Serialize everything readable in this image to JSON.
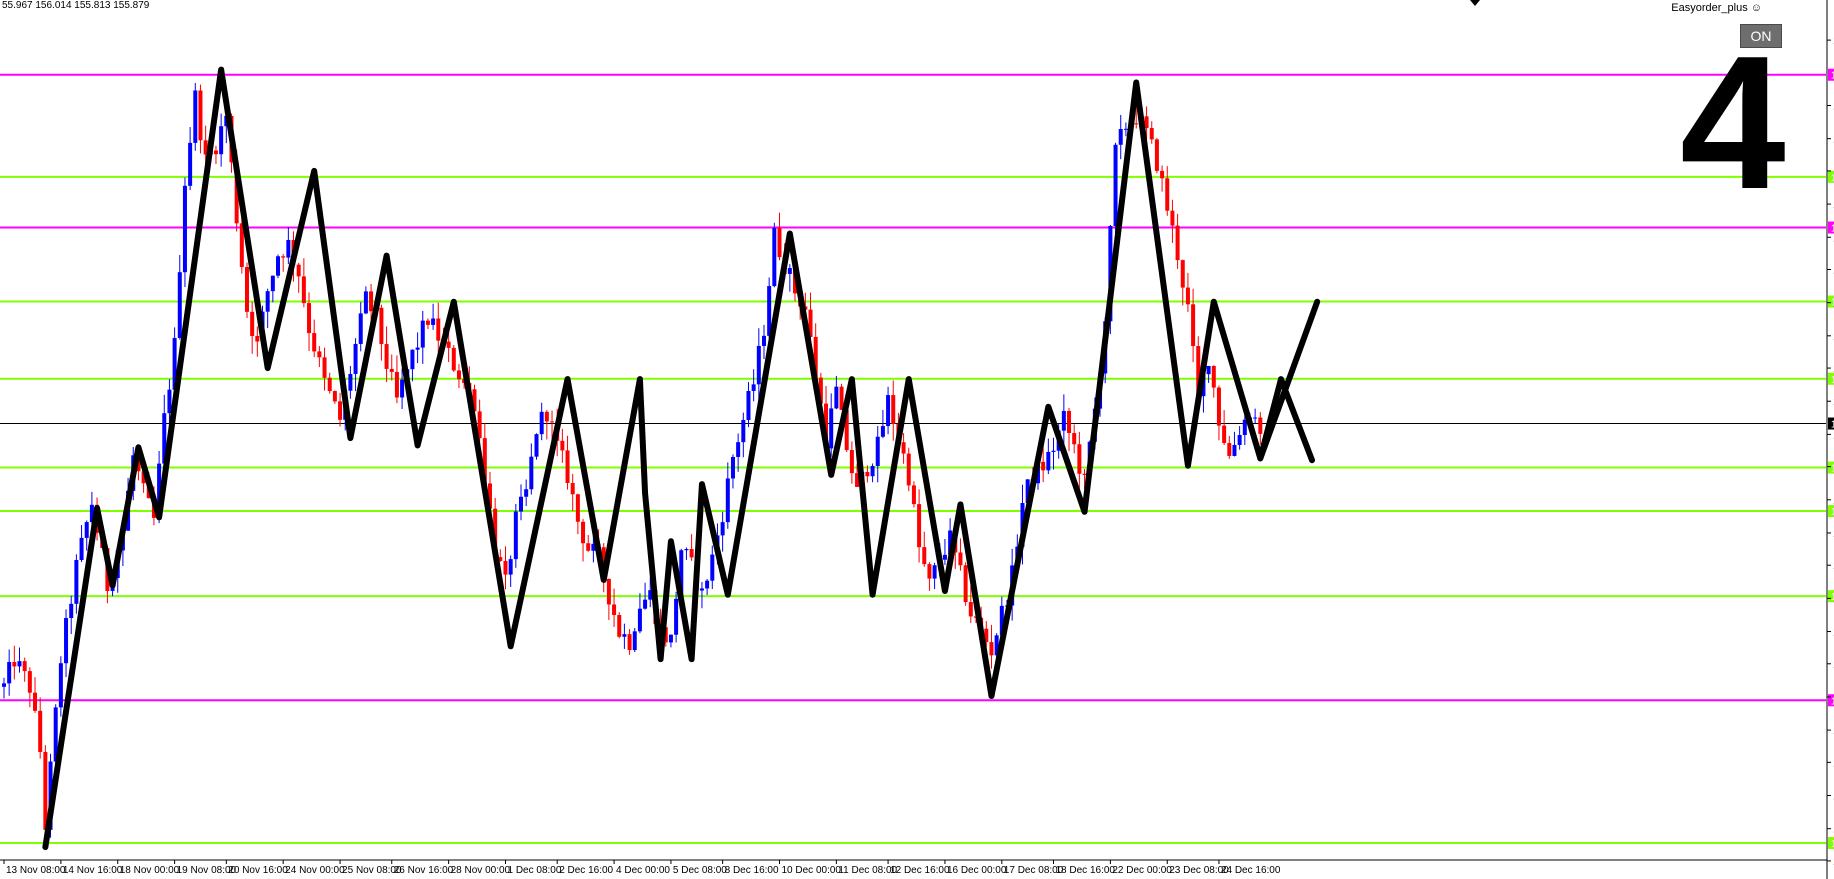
{
  "ohlc_readout": "55.967 156.014 155.813 155.879",
  "indicator_name": "Easyorder_plus",
  "on_button_label": "ON",
  "wave_count_label": "4",
  "colors": {
    "bull": "#0000ff",
    "bear": "#ff0000",
    "magenta_level": "#ff00ff",
    "green_level": "#7fff00",
    "zigzag": "#000000",
    "bid_line": "#000000"
  },
  "chart_data": {
    "type": "candlestick",
    "ylim": [
      153.51,
      158.08
    ],
    "price_ticks": [
      "157.960",
      "157.605",
      "157.425",
      "157.250",
      "157.070",
      "156.890",
      "156.715",
      "156.535",
      "156.355",
      "156.180",
      "156.000",
      "155.820",
      "155.645",
      "155.465",
      "155.285",
      "155.110",
      "154.930",
      "154.750",
      "154.575",
      "154.395",
      "154.215",
      "154.040",
      "153.860",
      "153.680",
      "153.505"
    ],
    "time_labels": [
      {
        "label": "13 Nov 08:00",
        "bar": 0
      },
      {
        "label": "14 Nov 16:00",
        "bar": 11
      },
      {
        "label": "18 Nov 00:00",
        "bar": 22
      },
      {
        "label": "19 Nov 08:00",
        "bar": 33
      },
      {
        "label": "20 Nov 16:00",
        "bar": 43
      },
      {
        "label": "24 Nov 00:00",
        "bar": 54
      },
      {
        "label": "25 Nov 08:00",
        "bar": 65
      },
      {
        "label": "26 Nov 16:00",
        "bar": 75
      },
      {
        "label": "28 Nov 00:00",
        "bar": 86
      },
      {
        "label": "1 Dec 08:00",
        "bar": 97
      },
      {
        "label": "2 Dec 16:00",
        "bar": 107
      },
      {
        "label": "4 Dec 00:00",
        "bar": 118
      },
      {
        "label": "5 Dec 08:00",
        "bar": 129
      },
      {
        "label": "8 Dec 16:00",
        "bar": 139
      },
      {
        "label": "10 Dec 00:00",
        "bar": 150
      },
      {
        "label": "11 Dec 08:00",
        "bar": 161
      },
      {
        "label": "12 Dec 16:00",
        "bar": 171
      },
      {
        "label": "16 Dec 00:00",
        "bar": 182
      },
      {
        "label": "17 Dec 08:00",
        "bar": 193
      },
      {
        "label": "18 Dec 16:00",
        "bar": 203
      },
      {
        "label": "22 Dec 00:00",
        "bar": 214
      },
      {
        "label": "23 Dec 08:00",
        "bar": 225
      },
      {
        "label": "24 Dec 16:00",
        "bar": 235
      }
    ],
    "levels": [
      {
        "price": 157.772,
        "label": "157.772",
        "kind": "magenta"
      },
      {
        "price": 157.218,
        "label": "157.218",
        "kind": "green"
      },
      {
        "price": 156.943,
        "label": "156.943",
        "kind": "magenta"
      },
      {
        "price": 156.541,
        "label": "156.541",
        "kind": "green"
      },
      {
        "price": 156.122,
        "label": "156.122",
        "kind": "green"
      },
      {
        "price": 155.64,
        "label": "155.640",
        "kind": "green"
      },
      {
        "price": 155.404,
        "label": "155.404",
        "kind": "green"
      },
      {
        "price": 154.942,
        "label": "154.942",
        "kind": "green"
      },
      {
        "price": 154.377,
        "label": "154.377",
        "kind": "magenta"
      },
      {
        "price": 153.602,
        "label": "153.602",
        "kind": "green"
      }
    ],
    "current_price": {
      "price": 155.879,
      "label": "155.879"
    },
    "waypoints": [
      [
        0,
        154.45
      ],
      [
        2,
        154.6
      ],
      [
        5,
        154.45
      ],
      [
        7,
        154.1
      ],
      [
        8,
        153.7
      ],
      [
        11,
        154.6
      ],
      [
        14,
        155.1
      ],
      [
        17,
        155.45
      ],
      [
        20,
        155.0
      ],
      [
        23,
        155.3
      ],
      [
        25,
        155.7
      ],
      [
        27,
        155.5
      ],
      [
        29,
        155.35
      ],
      [
        31,
        155.9
      ],
      [
        33,
        156.3
      ],
      [
        35,
        157.2
      ],
      [
        37,
        157.65
      ],
      [
        39,
        157.3
      ],
      [
        41,
        157.4
      ],
      [
        43,
        157.55
      ],
      [
        45,
        157.0
      ],
      [
        47,
        156.5
      ],
      [
        49,
        156.3
      ],
      [
        51,
        156.6
      ],
      [
        53,
        156.8
      ],
      [
        55,
        156.85
      ],
      [
        57,
        156.7
      ],
      [
        59,
        156.4
      ],
      [
        62,
        156.1
      ],
      [
        65,
        155.9
      ],
      [
        68,
        156.3
      ],
      [
        70,
        156.55
      ],
      [
        72,
        156.45
      ],
      [
        74,
        156.2
      ],
      [
        76,
        156.0
      ],
      [
        79,
        156.25
      ],
      [
        82,
        156.45
      ],
      [
        85,
        156.3
      ],
      [
        87,
        156.2
      ],
      [
        89,
        156.1
      ],
      [
        91,
        156.0
      ],
      [
        93,
        155.6
      ],
      [
        95,
        155.2
      ],
      [
        97,
        155.0
      ],
      [
        99,
        155.35
      ],
      [
        101,
        155.5
      ],
      [
        103,
        155.85
      ],
      [
        105,
        155.95
      ],
      [
        107,
        155.75
      ],
      [
        109,
        155.6
      ],
      [
        111,
        155.35
      ],
      [
        113,
        155.2
      ],
      [
        115,
        155.15
      ],
      [
        117,
        154.95
      ],
      [
        119,
        154.75
      ],
      [
        121,
        154.7
      ],
      [
        123,
        154.9
      ],
      [
        125,
        154.95
      ],
      [
        127,
        154.75
      ],
      [
        129,
        154.7
      ],
      [
        131,
        155.2
      ],
      [
        133,
        155.1
      ],
      [
        135,
        154.95
      ],
      [
        137,
        155.15
      ],
      [
        139,
        155.4
      ],
      [
        141,
        155.7
      ],
      [
        143,
        155.9
      ],
      [
        145,
        156.1
      ],
      [
        147,
        156.4
      ],
      [
        149,
        156.9
      ],
      [
        151,
        156.75
      ],
      [
        153,
        156.6
      ],
      [
        155,
        156.5
      ],
      [
        157,
        156.15
      ],
      [
        159,
        155.8
      ],
      [
        161,
        156.05
      ],
      [
        163,
        155.75
      ],
      [
        165,
        155.5
      ],
      [
        167,
        155.65
      ],
      [
        169,
        155.75
      ],
      [
        171,
        156.0
      ],
      [
        173,
        155.8
      ],
      [
        175,
        155.6
      ],
      [
        177,
        155.2
      ],
      [
        179,
        155.0
      ],
      [
        181,
        155.15
      ],
      [
        183,
        155.25
      ],
      [
        185,
        155.05
      ],
      [
        187,
        154.85
      ],
      [
        189,
        154.75
      ],
      [
        191,
        154.65
      ],
      [
        193,
        154.85
      ],
      [
        195,
        155.05
      ],
      [
        197,
        155.45
      ],
      [
        199,
        155.6
      ],
      [
        201,
        155.65
      ],
      [
        203,
        155.75
      ],
      [
        205,
        155.9
      ],
      [
        207,
        155.75
      ],
      [
        209,
        155.55
      ],
      [
        211,
        155.95
      ],
      [
        213,
        156.45
      ],
      [
        215,
        157.35
      ],
      [
        217,
        157.5
      ],
      [
        219,
        157.55
      ],
      [
        221,
        157.45
      ],
      [
        223,
        157.3
      ],
      [
        225,
        157.05
      ],
      [
        227,
        156.8
      ],
      [
        229,
        156.5
      ],
      [
        231,
        156.0
      ],
      [
        233,
        156.25
      ],
      [
        235,
        155.9
      ],
      [
        237,
        155.7
      ],
      [
        239,
        155.85
      ],
      [
        241,
        155.95
      ],
      [
        243,
        155.85
      ]
    ],
    "zigzag": [
      [
        8,
        153.58
      ],
      [
        18,
        155.42
      ],
      [
        21,
        155.0
      ],
      [
        26,
        155.75
      ],
      [
        30,
        155.37
      ],
      [
        42,
        157.8
      ],
      [
        51,
        156.18
      ],
      [
        60,
        157.25
      ],
      [
        67,
        155.8
      ],
      [
        74,
        156.79
      ],
      [
        80,
        155.76
      ],
      [
        87,
        156.54
      ],
      [
        98,
        154.67
      ],
      [
        109,
        156.12
      ],
      [
        116,
        155.03
      ],
      [
        123,
        156.12
      ],
      [
        124,
        155.5
      ],
      [
        127,
        154.6
      ],
      [
        129,
        155.24
      ],
      [
        133,
        154.6
      ],
      [
        135,
        155.55
      ],
      [
        140,
        154.95
      ],
      [
        152,
        156.91
      ],
      [
        160,
        155.6
      ],
      [
        164,
        156.12
      ],
      [
        168,
        154.95
      ],
      [
        175,
        156.12
      ],
      [
        182,
        154.97
      ],
      [
        185,
        155.44
      ],
      [
        191,
        154.4
      ],
      [
        202,
        155.97
      ],
      [
        209,
        155.4
      ],
      [
        219,
        157.73
      ],
      [
        229,
        155.65
      ],
      [
        234,
        156.54
      ],
      [
        243,
        155.69
      ],
      [
        247,
        156.12
      ],
      [
        253,
        155.68
      ]
    ],
    "zigzag_projection": [
      [
        243,
        155.69
      ],
      [
        254,
        156.54
      ]
    ]
  }
}
